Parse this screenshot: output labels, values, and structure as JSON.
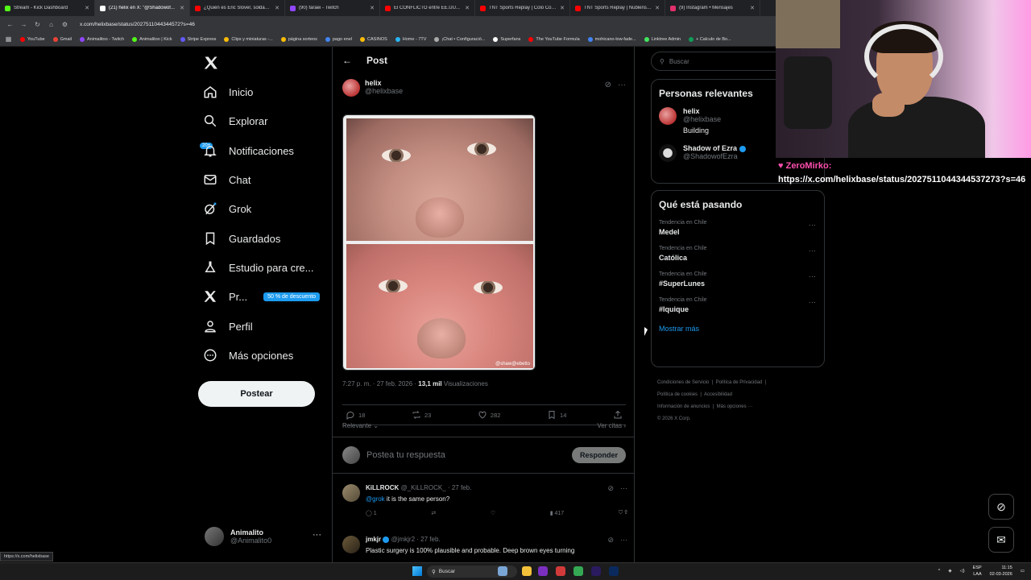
{
  "browser": {
    "tabs": [
      {
        "title": "Stream - Kick Dashboard",
        "color": "#53fc18"
      },
      {
        "title": "(21) helix en X: \"@Shadowof...",
        "color": "#ffffff"
      },
      {
        "title": "¿Quién es Eric Slover, soldado...",
        "color": "#ff0000"
      },
      {
        "title": "(90) faraei - Twitch",
        "color": "#9146ff"
      },
      {
        "title": "El CONFLICTO entre EE.UU...",
        "color": "#ff0000"
      },
      {
        "title": "TNT Sports Replay | Colo Colo...",
        "color": "#ff0000"
      },
      {
        "title": "TNT Sports Replay | Ñublense...",
        "color": "#ff0000"
      },
      {
        "title": "(9) Instagram • Mensajes",
        "color": "#e1306c"
      }
    ],
    "url": "x.com/helixbase/status/2027511044344572?s=46",
    "bookmarks": [
      "YouTube",
      "Gmail",
      "Animalitoo - Twitch",
      "Animalitoo | Kick",
      "Stripe Express",
      "Clips y miniaturas -...",
      "página sorteos",
      "pago enel",
      "CASINOS",
      "Home - 7TV",
      "¡Chat • Configuració...",
      "Superfans",
      "The YouTube Formula",
      "mohicano-low-fade...",
      "Linktree Admin",
      "+ Calculo de Bo..."
    ]
  },
  "nav": {
    "items": [
      {
        "label": "Inicio"
      },
      {
        "label": "Explorar"
      },
      {
        "label": "Notificaciones"
      },
      {
        "label": "Chat"
      },
      {
        "label": "Grok"
      },
      {
        "label": "Guardados"
      },
      {
        "label": "Estudio para cre..."
      },
      {
        "label": "Pr..."
      },
      {
        "label": "Perfil"
      },
      {
        "label": "Más opciones"
      }
    ],
    "notif_badge": "20+",
    "promo": "50 % de descuento",
    "post_button": "Postear",
    "account_name": "Animalito",
    "account_handle": "@Animalito0",
    "status_url": "https://x.com/helixbase"
  },
  "post": {
    "header_title": "Post",
    "author_name": "helix",
    "author_handle": "@helixbase",
    "watermark": "@shaw@ebetto",
    "time": "7:27 p. m.",
    "date": "27 feb. 2026",
    "views_count": "13,1 mil",
    "views_label": "Visualizaciones",
    "stats": {
      "replies": "18",
      "reposts": "23",
      "likes": "282",
      "bookmarks": "14"
    },
    "sort_label": "Relevante",
    "quotes_label": "Ver citas",
    "reply_placeholder": "Postea tu respuesta",
    "reply_button": "Responder"
  },
  "comments": [
    {
      "name": "KiLLROCK",
      "handle": "@_KiLLROCK_",
      "date": "· 27 feb.",
      "mention": "@grok",
      "text": " it is the same person?",
      "replies": "1",
      "views": "417"
    },
    {
      "name": "jmkjr",
      "handle": "@jmkjr2",
      "date": "· 27 feb.",
      "mention": "",
      "text": "Plastic surgery is 100% plausible and probable.  Deep brown eyes turning"
    }
  ],
  "right": {
    "search_placeholder": "Buscar",
    "relevant_title": "Personas relevantes",
    "people": [
      {
        "name": "helix",
        "handle": "@helixbase",
        "bio": "Building"
      },
      {
        "name": "Shadow of Ezra",
        "handle": "@ShadowofEzra"
      }
    ],
    "trends_title": "Qué está pasando",
    "trends": [
      {
        "context": "Tendencia en Chile",
        "name": "Medel"
      },
      {
        "context": "Tendencia en Chile",
        "name": "Católica"
      },
      {
        "context": "Tendencia en Chile",
        "name": "#SuperLunes"
      },
      {
        "context": "Tendencia en Chile",
        "name": "#Iquique"
      }
    ],
    "show_more": "Mostrar más",
    "footer": [
      "Condiciones de Servicio",
      "Política de Privacidad",
      "Política de cookies",
      "Accesibilidad",
      "Información de anuncios",
      "Más opciones ···",
      "© 2026 X Corp."
    ]
  },
  "stream_chat": {
    "user": "ZeroMirko:",
    "message": "https://x.com/helixbase/status/2027511044344537273?s=46"
  },
  "taskbar": {
    "search": "Buscar",
    "lang": "ESP",
    "region": "LAA",
    "time": "11:15",
    "date": "02-03-2026"
  }
}
